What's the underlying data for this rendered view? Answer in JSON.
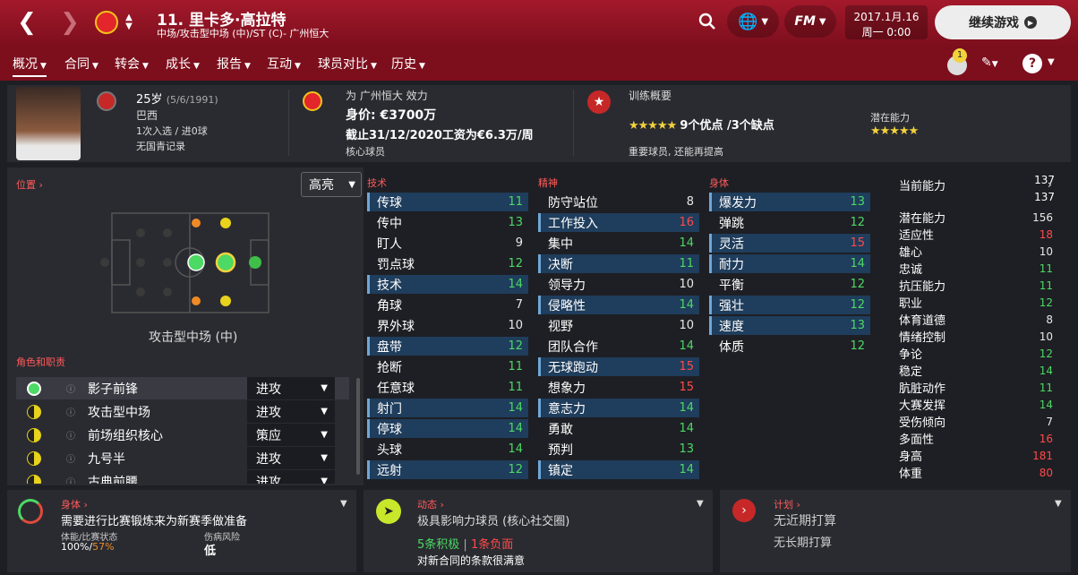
{
  "header": {
    "player_title": "11. 里卡多·高拉特",
    "player_sub": "中场/攻击型中场 (中)/ST (C)- 广州恒大",
    "date": "2017.1月.16",
    "time": "周一 0:00",
    "continue_label": "继续游戏",
    "fm_logo": "FM"
  },
  "nav": {
    "items": [
      "概况",
      "合同",
      "转会",
      "成长",
      "报告",
      "互动",
      "球员对比",
      "历史"
    ],
    "notifications": "1"
  },
  "profile": {
    "age": "25岁",
    "dob": "(5/6/1991)",
    "nation": "巴西",
    "caps": "1次入选 / 进0球",
    "youth": "无国青记录",
    "club_line": "为 广州恒大 效力",
    "value": "身价: €3700万",
    "contract": "截止31/12/2020工资为€6.3万/周",
    "squad_status": "核心球员",
    "training_title": "训练概要",
    "pros_cons": "9个优点 /3个缺点",
    "training_note": "重要球员, 还能再提高",
    "potential_label": "潜在能力"
  },
  "pitch": {
    "position_label": "位置",
    "highlight": "高亮",
    "position_name": "攻击型中场 (中)",
    "roles_label": "角色和职责"
  },
  "roles": [
    {
      "name": "影子前锋",
      "duty": "进攻"
    },
    {
      "name": "攻击型中场",
      "duty": "进攻"
    },
    {
      "name": "前场组织核心",
      "duty": "策应"
    },
    {
      "name": "九号半",
      "duty": "进攻"
    },
    {
      "name": "古典前腰",
      "duty": "进攻"
    }
  ],
  "technical": {
    "title": "技术",
    "rows": [
      {
        "n": "传球",
        "v": "11",
        "c": "g",
        "h": 1
      },
      {
        "n": "传中",
        "v": "13",
        "c": "g",
        "h": 0
      },
      {
        "n": "盯人",
        "v": "9",
        "c": "w",
        "h": 0
      },
      {
        "n": "罚点球",
        "v": "12",
        "c": "g",
        "h": 0
      },
      {
        "n": "技术",
        "v": "14",
        "c": "g",
        "h": 1
      },
      {
        "n": "角球",
        "v": "7",
        "c": "w",
        "h": 0
      },
      {
        "n": "界外球",
        "v": "10",
        "c": "w",
        "h": 0
      },
      {
        "n": "盘带",
        "v": "12",
        "c": "g",
        "h": 1
      },
      {
        "n": "抢断",
        "v": "11",
        "c": "g",
        "h": 0
      },
      {
        "n": "任意球",
        "v": "11",
        "c": "g",
        "h": 0
      },
      {
        "n": "射门",
        "v": "14",
        "c": "g",
        "h": 1
      },
      {
        "n": "停球",
        "v": "14",
        "c": "g",
        "h": 1
      },
      {
        "n": "头球",
        "v": "14",
        "c": "g",
        "h": 0
      },
      {
        "n": "远射",
        "v": "12",
        "c": "g",
        "h": 1
      }
    ]
  },
  "mental": {
    "title": "精神",
    "rows": [
      {
        "n": "防守站位",
        "v": "8",
        "c": "w",
        "h": 0
      },
      {
        "n": "工作投入",
        "v": "16",
        "c": "r",
        "h": 1
      },
      {
        "n": "集中",
        "v": "14",
        "c": "g",
        "h": 0
      },
      {
        "n": "决断",
        "v": "11",
        "c": "g",
        "h": 1
      },
      {
        "n": "领导力",
        "v": "10",
        "c": "w",
        "h": 0
      },
      {
        "n": "侵略性",
        "v": "14",
        "c": "g",
        "h": 1
      },
      {
        "n": "视野",
        "v": "10",
        "c": "w",
        "h": 0
      },
      {
        "n": "团队合作",
        "v": "14",
        "c": "g",
        "h": 0
      },
      {
        "n": "无球跑动",
        "v": "15",
        "c": "r",
        "h": 1
      },
      {
        "n": "想象力",
        "v": "15",
        "c": "r",
        "h": 0
      },
      {
        "n": "意志力",
        "v": "14",
        "c": "g",
        "h": 1
      },
      {
        "n": "勇敢",
        "v": "14",
        "c": "g",
        "h": 0
      },
      {
        "n": "预判",
        "v": "13",
        "c": "g",
        "h": 0
      },
      {
        "n": "镇定",
        "v": "14",
        "c": "g",
        "h": 1
      }
    ]
  },
  "physical": {
    "title": "身体",
    "rows": [
      {
        "n": "爆发力",
        "v": "13",
        "c": "g",
        "h": 1
      },
      {
        "n": "弹跳",
        "v": "12",
        "c": "g",
        "h": 0
      },
      {
        "n": "灵活",
        "v": "15",
        "c": "r",
        "h": 1
      },
      {
        "n": "耐力",
        "v": "14",
        "c": "g",
        "h": 1
      },
      {
        "n": "平衡",
        "v": "12",
        "c": "g",
        "h": 0
      },
      {
        "n": "强壮",
        "v": "12",
        "c": "g",
        "h": 1
      },
      {
        "n": "速度",
        "v": "13",
        "c": "g",
        "h": 1
      },
      {
        "n": "体质",
        "v": "12",
        "c": "g",
        "h": 0
      }
    ]
  },
  "stats": {
    "ca_label": "当前能力",
    "ca_top": "137",
    "ca": "137",
    "rows": [
      {
        "n": "潜在能力",
        "v": "156",
        "c": "w"
      },
      {
        "n": "适应性",
        "v": "18",
        "c": "r"
      },
      {
        "n": "雄心",
        "v": "10",
        "c": "w"
      },
      {
        "n": "忠诚",
        "v": "11",
        "c": "g"
      },
      {
        "n": "抗压能力",
        "v": "11",
        "c": "g"
      },
      {
        "n": "职业",
        "v": "12",
        "c": "g"
      },
      {
        "n": "体育道德",
        "v": "8",
        "c": "w"
      },
      {
        "n": "情绪控制",
        "v": "10",
        "c": "w"
      },
      {
        "n": "争论",
        "v": "12",
        "c": "g"
      },
      {
        "n": "稳定",
        "v": "14",
        "c": "g"
      },
      {
        "n": "肮脏动作",
        "v": "11",
        "c": "g"
      },
      {
        "n": "大赛发挥",
        "v": "14",
        "c": "g"
      },
      {
        "n": "受伤倾向",
        "v": "7",
        "c": "w"
      },
      {
        "n": "多面性",
        "v": "16",
        "c": "r"
      },
      {
        "n": "身高",
        "v": "181",
        "c": "r"
      },
      {
        "n": "体重",
        "v": "80",
        "c": "r"
      }
    ]
  },
  "cards": {
    "body_title": "身体",
    "body_text": "需要进行比赛锻炼来为新赛季做准备",
    "fitness_label": "体能/比赛状态",
    "fitness_v1": "100%",
    "fitness_sep": "/",
    "fitness_v2": "57%",
    "injury_label": "伤病风险",
    "injury_value": "低",
    "dyn_title": "动态",
    "dyn_text": "极具影响力球员 (核心社交圈)",
    "pos_count": "5条积极",
    "sep": " | ",
    "neg_count": "1条负面",
    "dyn_note": "对新合同的条款很满意",
    "plan_title": "计划",
    "plan1": "无近期打算",
    "plan2": "无长期打算"
  },
  "colors": {
    "accent": "#a3192b",
    "positive": "#4cd964",
    "negative": "#ff4a4a"
  }
}
